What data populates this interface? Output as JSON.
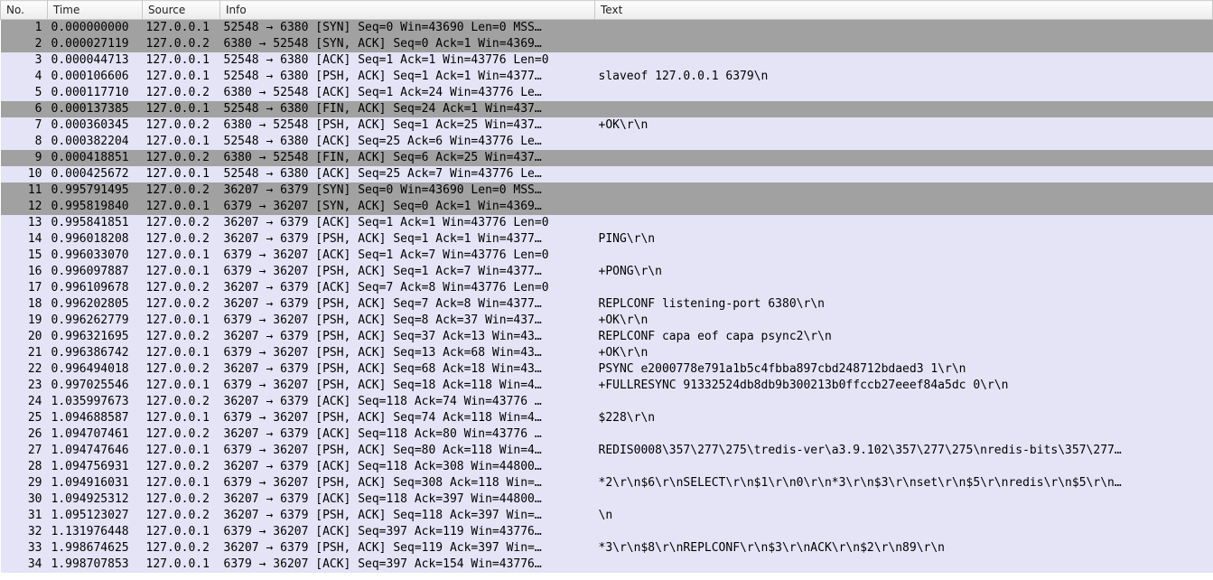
{
  "columns": {
    "no": "No.",
    "time": "Time",
    "src": "Source",
    "info": "Info",
    "text": "Text"
  },
  "rows": [
    {
      "no": "1",
      "time": "0.000000000",
      "src": "127.0.0.1",
      "info": "52548 → 6380 [SYN] Seq=0 Win=43690 Len=0 MSS…",
      "text": "",
      "style": "gray"
    },
    {
      "no": "2",
      "time": "0.000027119",
      "src": "127.0.0.2",
      "info": "6380 → 52548 [SYN, ACK] Seq=0 Ack=1 Win=4369…",
      "text": "",
      "style": "gray"
    },
    {
      "no": "3",
      "time": "0.000044713",
      "src": "127.0.0.1",
      "info": "52548 → 6380 [ACK] Seq=1 Ack=1 Win=43776 Len=0",
      "text": "",
      "style": "lilac"
    },
    {
      "no": "4",
      "time": "0.000106606",
      "src": "127.0.0.1",
      "info": "52548 → 6380 [PSH, ACK] Seq=1 Ack=1 Win=4377…",
      "text": "slaveof 127.0.0.1 6379\\n",
      "style": "lilac"
    },
    {
      "no": "5",
      "time": "0.000117710",
      "src": "127.0.0.2",
      "info": "6380 → 52548 [ACK] Seq=1 Ack=24 Win=43776 Le…",
      "text": "",
      "style": "lilac"
    },
    {
      "no": "6",
      "time": "0.000137385",
      "src": "127.0.0.1",
      "info": "52548 → 6380 [FIN, ACK] Seq=24 Ack=1 Win=437…",
      "text": "",
      "style": "gray"
    },
    {
      "no": "7",
      "time": "0.000360345",
      "src": "127.0.0.2",
      "info": "6380 → 52548 [PSH, ACK] Seq=1 Ack=25 Win=437…",
      "text": "+OK\\r\\n",
      "style": "lilac"
    },
    {
      "no": "8",
      "time": "0.000382204",
      "src": "127.0.0.1",
      "info": "52548 → 6380 [ACK] Seq=25 Ack=6 Win=43776 Le…",
      "text": "",
      "style": "lilac"
    },
    {
      "no": "9",
      "time": "0.000418851",
      "src": "127.0.0.2",
      "info": "6380 → 52548 [FIN, ACK] Seq=6 Ack=25 Win=437…",
      "text": "",
      "style": "gray"
    },
    {
      "no": "10",
      "time": "0.000425672",
      "src": "127.0.0.1",
      "info": "52548 → 6380 [ACK] Seq=25 Ack=7 Win=43776 Le…",
      "text": "",
      "style": "lilac"
    },
    {
      "no": "11",
      "time": "0.995791495",
      "src": "127.0.0.2",
      "info": "36207 → 6379 [SYN] Seq=0 Win=43690 Len=0 MSS…",
      "text": "",
      "style": "gray"
    },
    {
      "no": "12",
      "time": "0.995819840",
      "src": "127.0.0.1",
      "info": "6379 → 36207 [SYN, ACK] Seq=0 Ack=1 Win=4369…",
      "text": "",
      "style": "gray"
    },
    {
      "no": "13",
      "time": "0.995841851",
      "src": "127.0.0.2",
      "info": "36207 → 6379 [ACK] Seq=1 Ack=1 Win=43776 Len=0",
      "text": "",
      "style": "lilac"
    },
    {
      "no": "14",
      "time": "0.996018208",
      "src": "127.0.0.2",
      "info": "36207 → 6379 [PSH, ACK] Seq=1 Ack=1 Win=4377…",
      "text": "PING\\r\\n",
      "style": "lilac"
    },
    {
      "no": "15",
      "time": "0.996033070",
      "src": "127.0.0.1",
      "info": "6379 → 36207 [ACK] Seq=1 Ack=7 Win=43776 Len=0",
      "text": "",
      "style": "lilac"
    },
    {
      "no": "16",
      "time": "0.996097887",
      "src": "127.0.0.1",
      "info": "6379 → 36207 [PSH, ACK] Seq=1 Ack=7 Win=4377…",
      "text": "+PONG\\r\\n",
      "style": "lilac"
    },
    {
      "no": "17",
      "time": "0.996109678",
      "src": "127.0.0.2",
      "info": "36207 → 6379 [ACK] Seq=7 Ack=8 Win=43776 Len=0",
      "text": "",
      "style": "lilac"
    },
    {
      "no": "18",
      "time": "0.996202805",
      "src": "127.0.0.2",
      "info": "36207 → 6379 [PSH, ACK] Seq=7 Ack=8 Win=4377…",
      "text": "REPLCONF listening-port 6380\\r\\n",
      "style": "lilac"
    },
    {
      "no": "19",
      "time": "0.996262779",
      "src": "127.0.0.1",
      "info": "6379 → 36207 [PSH, ACK] Seq=8 Ack=37 Win=437…",
      "text": "+OK\\r\\n",
      "style": "lilac"
    },
    {
      "no": "20",
      "time": "0.996321695",
      "src": "127.0.0.2",
      "info": "36207 → 6379 [PSH, ACK] Seq=37 Ack=13 Win=43…",
      "text": "REPLCONF capa eof capa psync2\\r\\n",
      "style": "lilac"
    },
    {
      "no": "21",
      "time": "0.996386742",
      "src": "127.0.0.1",
      "info": "6379 → 36207 [PSH, ACK] Seq=13 Ack=68 Win=43…",
      "text": "+OK\\r\\n",
      "style": "lilac"
    },
    {
      "no": "22",
      "time": "0.996494018",
      "src": "127.0.0.2",
      "info": "36207 → 6379 [PSH, ACK] Seq=68 Ack=18 Win=43…",
      "text": "PSYNC e2000778e791a1b5c4fbba897cbd248712bdaed3 1\\r\\n",
      "style": "lilac"
    },
    {
      "no": "23",
      "time": "0.997025546",
      "src": "127.0.0.1",
      "info": "6379 → 36207 [PSH, ACK] Seq=18 Ack=118 Win=4…",
      "text": "+FULLRESYNC 91332524db8db9b300213b0ffccb27eeef84a5dc 0\\r\\n",
      "style": "lilac"
    },
    {
      "no": "24",
      "time": "1.035997673",
      "src": "127.0.0.2",
      "info": "36207 → 6379 [ACK] Seq=118 Ack=74 Win=43776 …",
      "text": "",
      "style": "lilac"
    },
    {
      "no": "25",
      "time": "1.094688587",
      "src": "127.0.0.1",
      "info": "6379 → 36207 [PSH, ACK] Seq=74 Ack=118 Win=4…",
      "text": "$228\\r\\n",
      "style": "lilac"
    },
    {
      "no": "26",
      "time": "1.094707461",
      "src": "127.0.0.2",
      "info": "36207 → 6379 [ACK] Seq=118 Ack=80 Win=43776 …",
      "text": "",
      "style": "lilac"
    },
    {
      "no": "27",
      "time": "1.094747646",
      "src": "127.0.0.1",
      "info": "6379 → 36207 [PSH, ACK] Seq=80 Ack=118 Win=4…",
      "text": "REDIS0008\\357\\277\\275\\tredis-ver\\a3.9.102\\357\\277\\275\\nredis-bits\\357\\277…",
      "style": "lilac"
    },
    {
      "no": "28",
      "time": "1.094756931",
      "src": "127.0.0.2",
      "info": "36207 → 6379 [ACK] Seq=118 Ack=308 Win=44800…",
      "text": "",
      "style": "lilac"
    },
    {
      "no": "29",
      "time": "1.094916031",
      "src": "127.0.0.1",
      "info": "6379 → 36207 [PSH, ACK] Seq=308 Ack=118 Win=…",
      "text": "*2\\r\\n$6\\r\\nSELECT\\r\\n$1\\r\\n0\\r\\n*3\\r\\n$3\\r\\nset\\r\\n$5\\r\\nredis\\r\\n$5\\r\\n…",
      "style": "lilac"
    },
    {
      "no": "30",
      "time": "1.094925312",
      "src": "127.0.0.2",
      "info": "36207 → 6379 [ACK] Seq=118 Ack=397 Win=44800…",
      "text": "",
      "style": "lilac"
    },
    {
      "no": "31",
      "time": "1.095123027",
      "src": "127.0.0.2",
      "info": "36207 → 6379 [PSH, ACK] Seq=118 Ack=397 Win=…",
      "text": "\\n",
      "style": "lilac"
    },
    {
      "no": "32",
      "time": "1.131976448",
      "src": "127.0.0.1",
      "info": "6379 → 36207 [ACK] Seq=397 Ack=119 Win=43776…",
      "text": "",
      "style": "lilac"
    },
    {
      "no": "33",
      "time": "1.998674625",
      "src": "127.0.0.2",
      "info": "36207 → 6379 [PSH, ACK] Seq=119 Ack=397 Win=…",
      "text": "*3\\r\\n$8\\r\\nREPLCONF\\r\\n$3\\r\\nACK\\r\\n$2\\r\\n89\\r\\n",
      "style": "lilac"
    },
    {
      "no": "34",
      "time": "1.998707853",
      "src": "127.0.0.1",
      "info": "6379 → 36207 [ACK] Seq=397 Ack=154 Win=43776…",
      "text": "",
      "style": "lilac"
    }
  ]
}
